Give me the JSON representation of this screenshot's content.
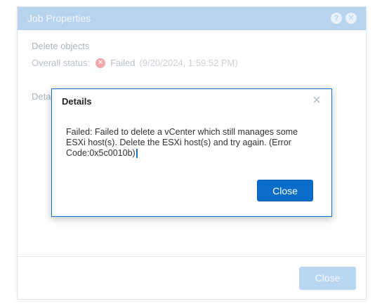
{
  "background_dialog": {
    "title": "Job Properties",
    "header_icons": [
      "help-icon",
      "close-icon"
    ],
    "header_help_glyph": "?",
    "header_close_glyph": "✕",
    "section_title": "Delete objects",
    "status_label": "Overall status:",
    "status_value": "Failed",
    "status_icon": "failed-icon",
    "status_time": "(9/20/2024, 1:59:52 PM)",
    "details_label": "Detai",
    "close_label": "Close"
  },
  "details_dialog": {
    "title": "Details",
    "close_x": "×",
    "message": "Failed: Failed to delete a vCenter which still manages some ESXi host(s). Delete the ESXi host(s) and try again. (Error Code:0x5c0010b)",
    "close_label": "Close"
  },
  "colors": {
    "header_bg": "#b7d3ee",
    "primary_button": "#0b6cc9",
    "dialog_border": "#1f6fc5",
    "failed_icon": "#f0a7a7"
  }
}
